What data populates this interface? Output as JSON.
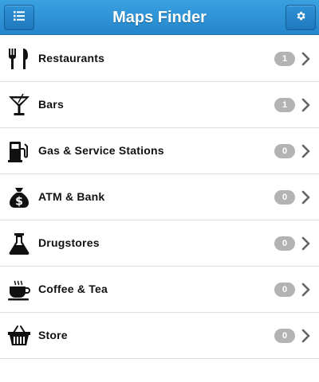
{
  "app": {
    "title": "Maps Finder",
    "accent": "#2a8fd4"
  },
  "header": {
    "left_icon": "list-menu-icon",
    "right_icon": "gear-icon"
  },
  "categories": [
    {
      "label": "Restaurants",
      "count": "1",
      "icon": "fork-knife-icon"
    },
    {
      "label": "Bars",
      "count": "1",
      "icon": "cocktail-glass-icon"
    },
    {
      "label": "Gas & Service Stations",
      "count": "0",
      "icon": "gas-pump-icon"
    },
    {
      "label": "ATM & Bank",
      "count": "0",
      "icon": "money-bag-icon"
    },
    {
      "label": "Drugstores",
      "count": "0",
      "icon": "flask-icon"
    },
    {
      "label": "Coffee & Tea",
      "count": "0",
      "icon": "coffee-cup-icon"
    },
    {
      "label": "Store",
      "count": "0",
      "icon": "shopping-basket-icon"
    }
  ],
  "colors": {
    "badge": "#b3b3b3",
    "chevron": "#666666",
    "divider": "#dedede"
  }
}
